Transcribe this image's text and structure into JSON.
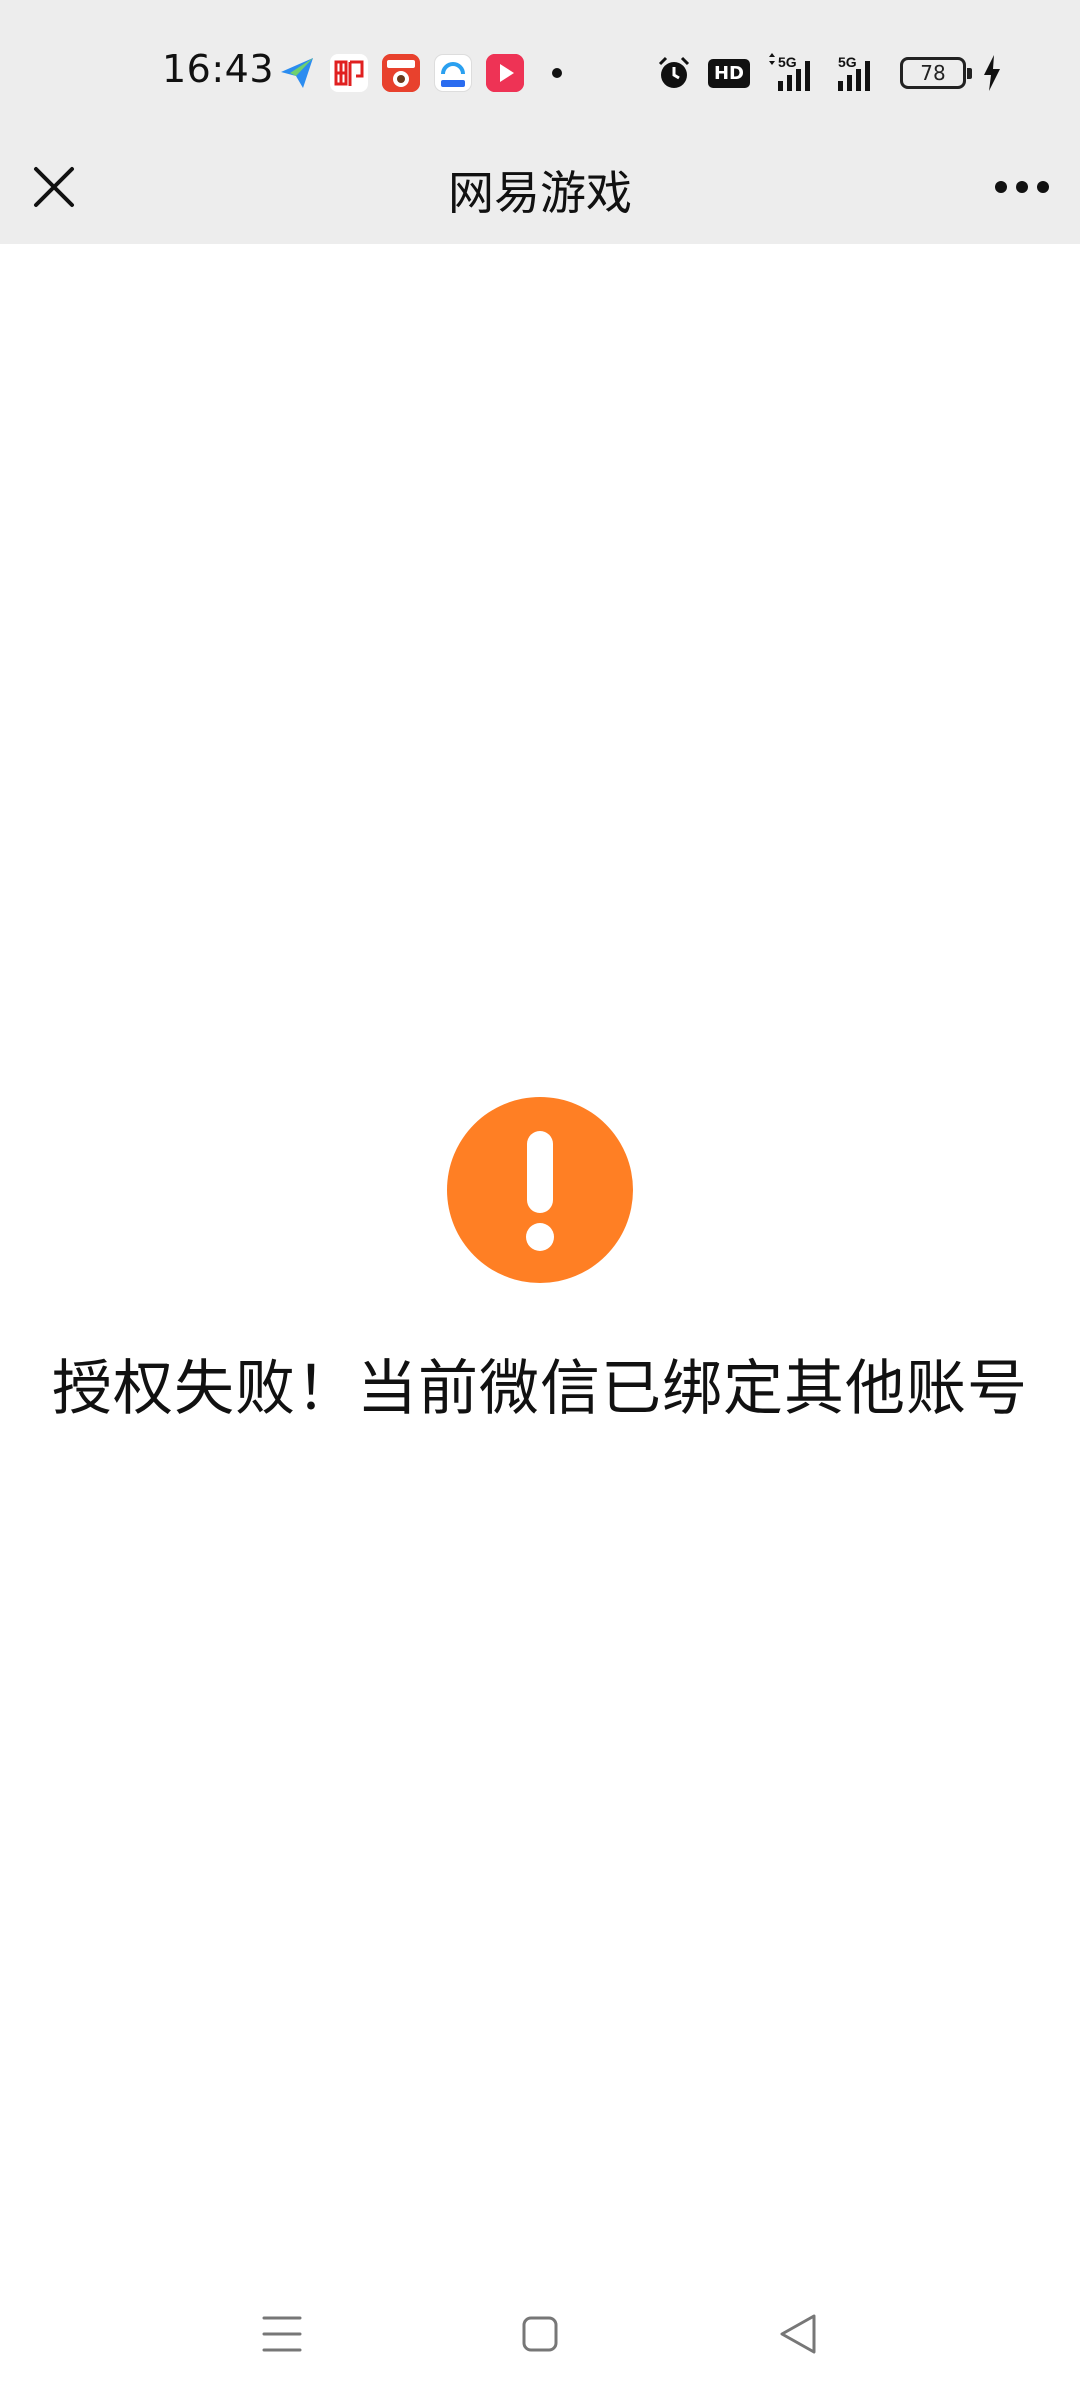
{
  "status_bar": {
    "time": "16:43",
    "notification_icons": [
      "paper-plane-icon",
      "mail-app-icon",
      "food-delivery-app-icon",
      "browser-app-icon",
      "video-app-icon"
    ],
    "network_1": "5G",
    "network_2": "5G",
    "hd_label": "HD",
    "battery_level": "78"
  },
  "header": {
    "title": "网易游戏"
  },
  "main": {
    "message": "授权失败！当前微信已绑定其他账号",
    "alert_color": "#ff7f24"
  },
  "colors": {
    "topbar_bg": "#ededed",
    "page_bg": "#ffffff",
    "accent": "#ff7f24"
  }
}
